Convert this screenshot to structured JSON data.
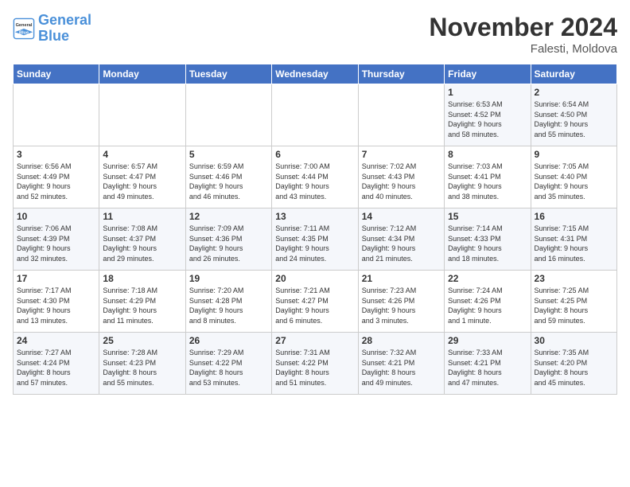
{
  "logo": {
    "line1": "General",
    "line2": "Blue"
  },
  "header": {
    "title": "November 2024",
    "location": "Falesti, Moldova"
  },
  "days_of_week": [
    "Sunday",
    "Monday",
    "Tuesday",
    "Wednesday",
    "Thursday",
    "Friday",
    "Saturday"
  ],
  "weeks": [
    [
      {
        "day": "",
        "info": ""
      },
      {
        "day": "",
        "info": ""
      },
      {
        "day": "",
        "info": ""
      },
      {
        "day": "",
        "info": ""
      },
      {
        "day": "",
        "info": ""
      },
      {
        "day": "1",
        "info": "Sunrise: 6:53 AM\nSunset: 4:52 PM\nDaylight: 9 hours\nand 58 minutes."
      },
      {
        "day": "2",
        "info": "Sunrise: 6:54 AM\nSunset: 4:50 PM\nDaylight: 9 hours\nand 55 minutes."
      }
    ],
    [
      {
        "day": "3",
        "info": "Sunrise: 6:56 AM\nSunset: 4:49 PM\nDaylight: 9 hours\nand 52 minutes."
      },
      {
        "day": "4",
        "info": "Sunrise: 6:57 AM\nSunset: 4:47 PM\nDaylight: 9 hours\nand 49 minutes."
      },
      {
        "day": "5",
        "info": "Sunrise: 6:59 AM\nSunset: 4:46 PM\nDaylight: 9 hours\nand 46 minutes."
      },
      {
        "day": "6",
        "info": "Sunrise: 7:00 AM\nSunset: 4:44 PM\nDaylight: 9 hours\nand 43 minutes."
      },
      {
        "day": "7",
        "info": "Sunrise: 7:02 AM\nSunset: 4:43 PM\nDaylight: 9 hours\nand 40 minutes."
      },
      {
        "day": "8",
        "info": "Sunrise: 7:03 AM\nSunset: 4:41 PM\nDaylight: 9 hours\nand 38 minutes."
      },
      {
        "day": "9",
        "info": "Sunrise: 7:05 AM\nSunset: 4:40 PM\nDaylight: 9 hours\nand 35 minutes."
      }
    ],
    [
      {
        "day": "10",
        "info": "Sunrise: 7:06 AM\nSunset: 4:39 PM\nDaylight: 9 hours\nand 32 minutes."
      },
      {
        "day": "11",
        "info": "Sunrise: 7:08 AM\nSunset: 4:37 PM\nDaylight: 9 hours\nand 29 minutes."
      },
      {
        "day": "12",
        "info": "Sunrise: 7:09 AM\nSunset: 4:36 PM\nDaylight: 9 hours\nand 26 minutes."
      },
      {
        "day": "13",
        "info": "Sunrise: 7:11 AM\nSunset: 4:35 PM\nDaylight: 9 hours\nand 24 minutes."
      },
      {
        "day": "14",
        "info": "Sunrise: 7:12 AM\nSunset: 4:34 PM\nDaylight: 9 hours\nand 21 minutes."
      },
      {
        "day": "15",
        "info": "Sunrise: 7:14 AM\nSunset: 4:33 PM\nDaylight: 9 hours\nand 18 minutes."
      },
      {
        "day": "16",
        "info": "Sunrise: 7:15 AM\nSunset: 4:31 PM\nDaylight: 9 hours\nand 16 minutes."
      }
    ],
    [
      {
        "day": "17",
        "info": "Sunrise: 7:17 AM\nSunset: 4:30 PM\nDaylight: 9 hours\nand 13 minutes."
      },
      {
        "day": "18",
        "info": "Sunrise: 7:18 AM\nSunset: 4:29 PM\nDaylight: 9 hours\nand 11 minutes."
      },
      {
        "day": "19",
        "info": "Sunrise: 7:20 AM\nSunset: 4:28 PM\nDaylight: 9 hours\nand 8 minutes."
      },
      {
        "day": "20",
        "info": "Sunrise: 7:21 AM\nSunset: 4:27 PM\nDaylight: 9 hours\nand 6 minutes."
      },
      {
        "day": "21",
        "info": "Sunrise: 7:23 AM\nSunset: 4:26 PM\nDaylight: 9 hours\nand 3 minutes."
      },
      {
        "day": "22",
        "info": "Sunrise: 7:24 AM\nSunset: 4:26 PM\nDaylight: 9 hours\nand 1 minute."
      },
      {
        "day": "23",
        "info": "Sunrise: 7:25 AM\nSunset: 4:25 PM\nDaylight: 8 hours\nand 59 minutes."
      }
    ],
    [
      {
        "day": "24",
        "info": "Sunrise: 7:27 AM\nSunset: 4:24 PM\nDaylight: 8 hours\nand 57 minutes."
      },
      {
        "day": "25",
        "info": "Sunrise: 7:28 AM\nSunset: 4:23 PM\nDaylight: 8 hours\nand 55 minutes."
      },
      {
        "day": "26",
        "info": "Sunrise: 7:29 AM\nSunset: 4:22 PM\nDaylight: 8 hours\nand 53 minutes."
      },
      {
        "day": "27",
        "info": "Sunrise: 7:31 AM\nSunset: 4:22 PM\nDaylight: 8 hours\nand 51 minutes."
      },
      {
        "day": "28",
        "info": "Sunrise: 7:32 AM\nSunset: 4:21 PM\nDaylight: 8 hours\nand 49 minutes."
      },
      {
        "day": "29",
        "info": "Sunrise: 7:33 AM\nSunset: 4:21 PM\nDaylight: 8 hours\nand 47 minutes."
      },
      {
        "day": "30",
        "info": "Sunrise: 7:35 AM\nSunset: 4:20 PM\nDaylight: 8 hours\nand 45 minutes."
      }
    ]
  ]
}
